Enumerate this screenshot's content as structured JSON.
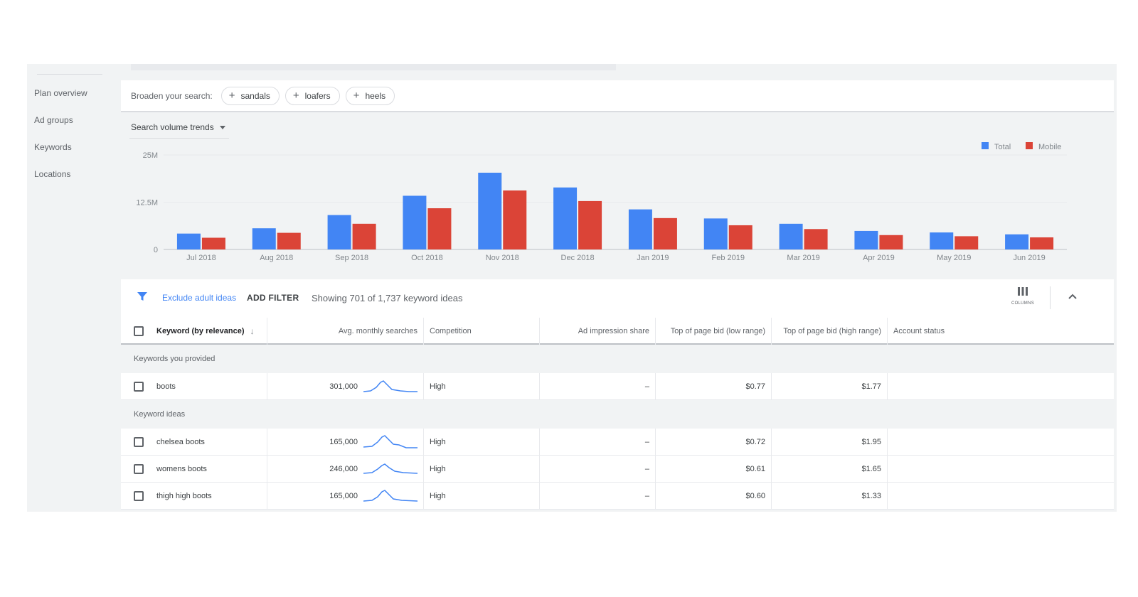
{
  "sidebar": {
    "items": [
      {
        "label": "Plan overview"
      },
      {
        "label": "Ad groups"
      },
      {
        "label": "Keywords"
      },
      {
        "label": "Locations"
      }
    ]
  },
  "broaden": {
    "label": "Broaden your search:",
    "chips": [
      {
        "label": "sandals"
      },
      {
        "label": "loafers"
      },
      {
        "label": "heels"
      }
    ]
  },
  "trends": {
    "selector_label": "Search volume trends"
  },
  "chart_data": {
    "type": "bar",
    "categories": [
      "Jul 2018",
      "Aug 2018",
      "Sep 2018",
      "Oct 2018",
      "Nov 2018",
      "Dec 2018",
      "Jan 2019",
      "Feb 2019",
      "Mar 2019",
      "Apr 2019",
      "May 2019",
      "Jun 2019"
    ],
    "series": [
      {
        "name": "Total",
        "color": "#4285f4",
        "values": [
          4.2,
          5.6,
          9.1,
          14.2,
          20.3,
          16.4,
          10.6,
          8.2,
          6.8,
          4.9,
          4.5,
          4.0
        ]
      },
      {
        "name": "Mobile",
        "color": "#db4437",
        "values": [
          3.1,
          4.4,
          6.8,
          10.9,
          15.6,
          12.8,
          8.3,
          6.4,
          5.4,
          3.8,
          3.5,
          3.2
        ]
      }
    ],
    "yticks": [
      "0",
      "12.5M",
      "25M"
    ],
    "ylim": [
      0,
      25
    ],
    "legend_position": "top-right",
    "grid": true
  },
  "filterbar": {
    "exclude_label": "Exclude adult ideas",
    "add_filter_label": "ADD FILTER",
    "showing_text": "Showing 701 of 1,737 keyword ideas",
    "columns_label": "COLUMNS"
  },
  "table": {
    "headers": {
      "keyword": "Keyword (by relevance)",
      "avg": "Avg. monthly searches",
      "competition": "Competition",
      "impression": "Ad impression share",
      "bid_low": "Top of page bid (low range)",
      "bid_high": "Top of page bid (high range)",
      "status": "Account status"
    },
    "sections": [
      {
        "title": "Keywords you provided",
        "rows": [
          {
            "keyword": "boots",
            "avg": "301,000",
            "competition": "High",
            "impression": "–",
            "bid_low": "$0.77",
            "bid_high": "$1.77",
            "status": ""
          }
        ]
      },
      {
        "title": "Keyword ideas",
        "rows": [
          {
            "keyword": "chelsea boots",
            "avg": "165,000",
            "competition": "High",
            "impression": "–",
            "bid_low": "$0.72",
            "bid_high": "$1.95",
            "status": ""
          },
          {
            "keyword": "womens boots",
            "avg": "246,000",
            "competition": "High",
            "impression": "–",
            "bid_low": "$0.61",
            "bid_high": "$1.65",
            "status": ""
          },
          {
            "keyword": "thigh high boots",
            "avg": "165,000",
            "competition": "High",
            "impression": "–",
            "bid_low": "$0.60",
            "bid_high": "$1.33",
            "status": ""
          }
        ]
      }
    ]
  },
  "colors": {
    "accent": "#4285f4",
    "mobile": "#db4437"
  }
}
